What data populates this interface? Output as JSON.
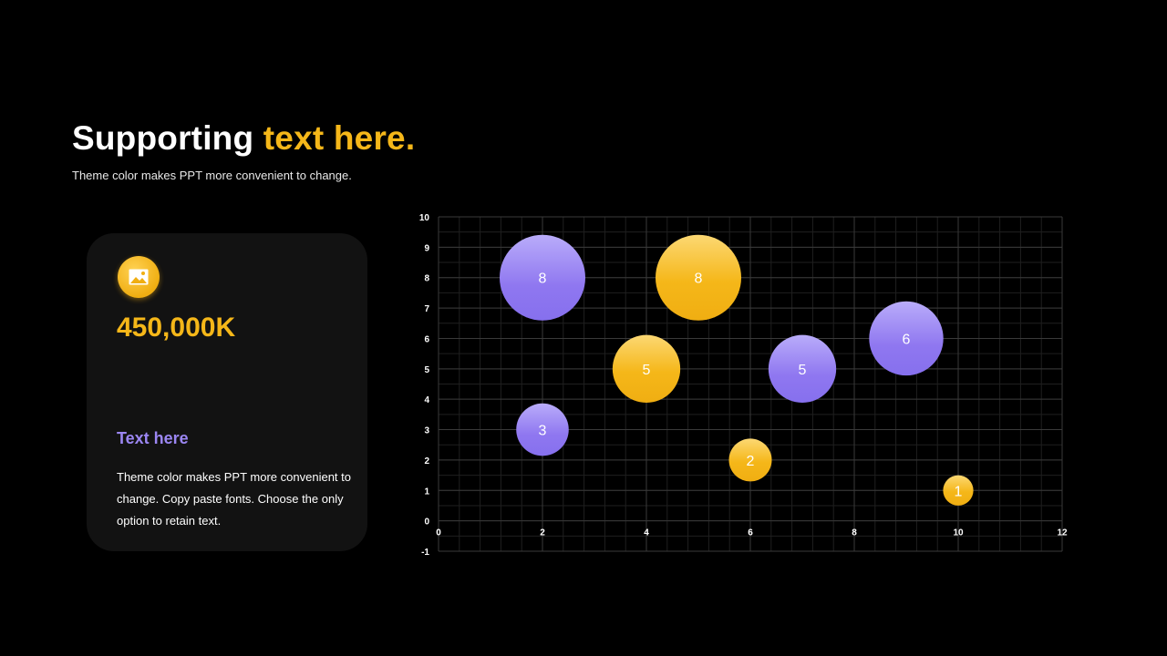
{
  "header": {
    "title_main": "Supporting",
    "title_accent": "text here.",
    "subtitle": "Theme color makes PPT more convenient to change."
  },
  "card": {
    "icon": "image-icon",
    "metric": "450,000K",
    "heading": "Text here",
    "body": "Theme color makes PPT more convenient to change. Copy paste fonts. Choose the only option to retain text."
  },
  "colors": {
    "background": "#000000",
    "card_background": "#121212",
    "accent_gold": "#F5B719",
    "accent_purple": "#9B86F2",
    "grid": "#2b2b2b"
  },
  "chart_data": {
    "type": "scatter",
    "variant": "bubble",
    "xlim": [
      0,
      12
    ],
    "ylim": [
      -1,
      10
    ],
    "x_ticks": [
      0,
      2,
      4,
      6,
      8,
      10,
      12
    ],
    "y_ticks": [
      -1,
      0,
      1,
      2,
      3,
      4,
      5,
      6,
      7,
      8,
      9,
      10
    ],
    "grid": true,
    "legend": "none",
    "series": [
      {
        "color": "gold",
        "points": [
          {
            "x": 4,
            "y": 5,
            "size": 5
          },
          {
            "x": 5,
            "y": 8,
            "size": 8
          },
          {
            "x": 6,
            "y": 2,
            "size": 2
          },
          {
            "x": 10,
            "y": 1,
            "size": 1
          }
        ]
      },
      {
        "color": "purple",
        "points": [
          {
            "x": 2,
            "y": 8,
            "size": 8
          },
          {
            "x": 2,
            "y": 3,
            "size": 3
          },
          {
            "x": 7,
            "y": 5,
            "size": 5
          },
          {
            "x": 9,
            "y": 6,
            "size": 6
          }
        ]
      }
    ]
  }
}
